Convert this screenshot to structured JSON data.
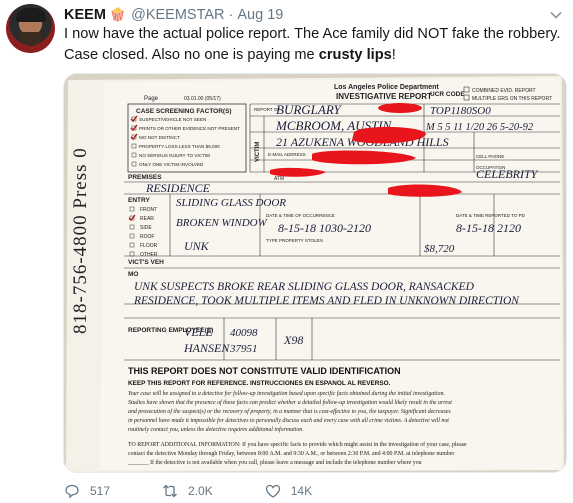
{
  "tweet": {
    "name": "KEEM",
    "emoji": "🍿",
    "handle": "@KEEMSTAR",
    "date": "Aug 19",
    "text_before": "I now have the actual police report. The Ace family did NOT fake the robbery. Case closed. Also no one is paying me ",
    "text_bold": "crusty lips",
    "text_after": "!"
  },
  "report": {
    "agency": "Los Angeles Police Department",
    "title": "INVESTIGATIVE REPORT",
    "ucr": "UCR CODE",
    "combined": "COMBINED EVID. REPORT",
    "multiple": "MULTIPLE GRS ON THIS REPORT",
    "page": "Page",
    "form_no": "03.01.00 (05/17)",
    "screening_title": "CASE SCREENING FACTOR(S)",
    "screening_items": [
      "SUSPECT/VEHICLE NOT SEEN",
      "PRINTS OR OTHER EVIDENCE NOT PRESENT",
      "MO NOT DISTINCT",
      "PROPERTY LOSS LESS THAN $5,000",
      "NO SERIOUS INJURY TO VICTIM",
      "ONLY ONE VICTIM INVOLVED"
    ],
    "report_of_label": "REPORT OF",
    "report_of": "BURGLARY",
    "file_no": "TOP1180SO0",
    "victim_name": "MCBROOM, AUSTIN",
    "victim_dob": "M 5 5 11 1/20 26 5-20-92",
    "address": "21 AZUKENA WOODLAND HILLS",
    "victim_label": "VICTIM",
    "email_label": "E-MAIL ADDRESS",
    "cell_label": "CELL PHONE",
    "occupation_label": "OCCUPATION",
    "occupation": "CELEBRITY",
    "premises_label": "PREMISES",
    "premises": "RESIDENCE",
    "atm_label": "ATM",
    "entry_label": "ENTRY",
    "entry_options": [
      "FRONT",
      "REAR",
      "SIDE",
      "ROOF",
      "FLOOR",
      "OTHER"
    ],
    "point_of_entry": "SLIDING GLASS DOOR",
    "method": "BROKEN WINDOW",
    "instrument": "UNK",
    "occurrence_label": "DATE & TIME OF OCCURRENCE",
    "occurrence": "8-15-18 1030-2120",
    "reported_label": "DATE & TIME REPORTED TO PD",
    "reported": "8-15-18 2120",
    "stolen_label": "TYPE PROPERTY STOLEN",
    "loss": "$8,720",
    "vict_veh_label": "VICT'S VEH",
    "mo_label": "MO",
    "mo_text_1": "UNK SUSPECTS BROKE REAR SLIDING GLASS DOOR, RANSACKED",
    "mo_text_2": "RESIDENCE, TOOK MULTIPLE ITEMS AND FLED IN UNKNOWN DIRECTION",
    "reporting_label": "REPORTING EMPLOYEE(S)",
    "emp1": "VELE",
    "emp2": "HANSEN",
    "serial1": "40098",
    "serial2": "37951",
    "division": "X98",
    "side_note": "818-756-4800 Press 0",
    "disclaimer": "THIS REPORT DOES NOT CONSTITUTE VALID IDENTIFICATION",
    "keep": "KEEP THIS REPORT FOR REFERENCE. INSTRUCCIONES EN ESPANOL AL REVERSO.",
    "para1": "Your case will be assigned to a detective for follow-up investigation based upon specific facts obtained during the initial investigation.",
    "para2": "Studies have shown that the presence of these facts can predict whether a detailed follow-up investigation would likely result in the arrest",
    "para3": "and prosecution of the suspect(s) or the recovery of property, in a manner that is cost-effective to you, the taxpayer. Significant decreases",
    "para4": "in personnel have made it impossible for detectives to personally discuss each and every case with all crime victims. A detective will not",
    "para5": "routinely contact you, unless the detective requires additional information.",
    "addl1": "TO REPORT ADDITIONAL INFORMATION:   If you have specific facts to provide which might assist in the investigation of your case, please",
    "addl2": "contact the detective Monday through Friday, between 8:00 A.M. and 9:30 A.M., or between 2:30 P.M. and 4:00 P.M. at telephone number",
    "addl3": "_______ If the detective is not available when you call, please leave a message and include the telephone number where you"
  },
  "actions": {
    "replies": "517",
    "retweets": "2.0K",
    "likes": "14K"
  },
  "colors": {
    "redaction": "#e8161c",
    "muted": "#657786"
  }
}
